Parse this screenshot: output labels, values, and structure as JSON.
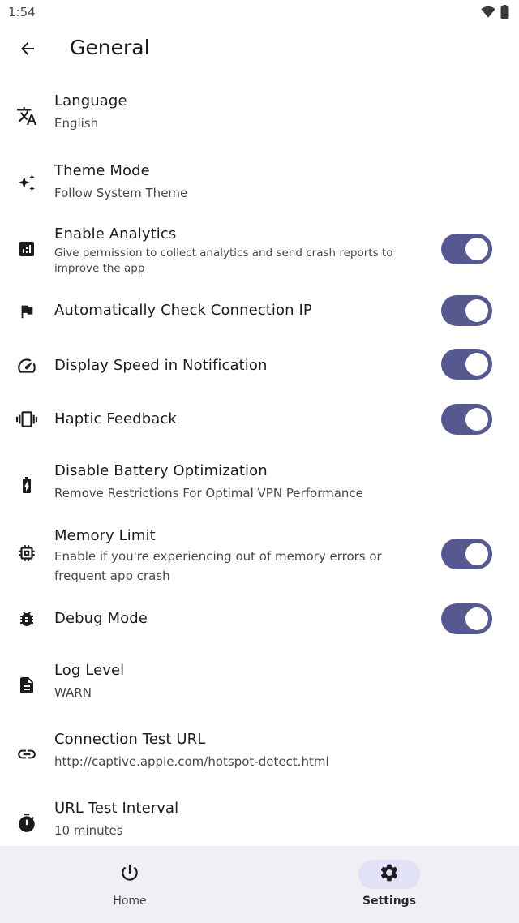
{
  "status_bar": {
    "time": "1:54",
    "icons": [
      "wifi-icon",
      "battery-icon"
    ]
  },
  "app_bar": {
    "title": "General",
    "back_icon": "arrow-left-icon"
  },
  "settings": [
    {
      "icon": "translate-icon",
      "title": "Language",
      "subtitle": "English",
      "toggle": null
    },
    {
      "icon": "sparkles-icon",
      "title": "Theme Mode",
      "subtitle": "Follow System Theme",
      "toggle": null
    },
    {
      "icon": "analytics-icon",
      "title": "Enable Analytics",
      "subtitle": "Give permission to collect analytics and send crash reports to improve the app",
      "toggle": true
    },
    {
      "icon": "flag-icon",
      "title": "Automatically Check Connection IP",
      "subtitle": "",
      "toggle": true
    },
    {
      "icon": "speedometer-icon",
      "title": "Display Speed in Notification",
      "subtitle": "",
      "toggle": true
    },
    {
      "icon": "vibration-icon",
      "title": "Haptic Feedback",
      "subtitle": "",
      "toggle": true
    },
    {
      "icon": "battery-charging-icon",
      "title": "Disable Battery Optimization",
      "subtitle": "Remove Restrictions For Optimal VPN Performance",
      "toggle": null
    },
    {
      "icon": "memory-chip-icon",
      "title": "Memory Limit",
      "subtitle": "Enable if you're experiencing out of memory errors or frequent app crash",
      "toggle": true
    },
    {
      "icon": "bug-icon",
      "title": "Debug Mode",
      "subtitle": "",
      "toggle": true
    },
    {
      "icon": "document-icon",
      "title": "Log Level",
      "subtitle": "WARN",
      "toggle": null
    },
    {
      "icon": "link-icon",
      "title": "Connection Test URL",
      "subtitle": "http://captive.apple.com/hotspot-detect.html",
      "toggle": null
    },
    {
      "icon": "timer-icon",
      "title": "URL Test Interval",
      "subtitle": "10 minutes",
      "toggle": null
    }
  ],
  "bottom_nav": {
    "items": [
      {
        "label": "Home",
        "icon": "power-icon",
        "active": false
      },
      {
        "label": "Settings",
        "icon": "gear-icon",
        "active": true
      }
    ]
  },
  "colors": {
    "toggle_track": "#55598f",
    "nav_background": "#f1eff4",
    "active_pill": "#e1e2f7"
  }
}
